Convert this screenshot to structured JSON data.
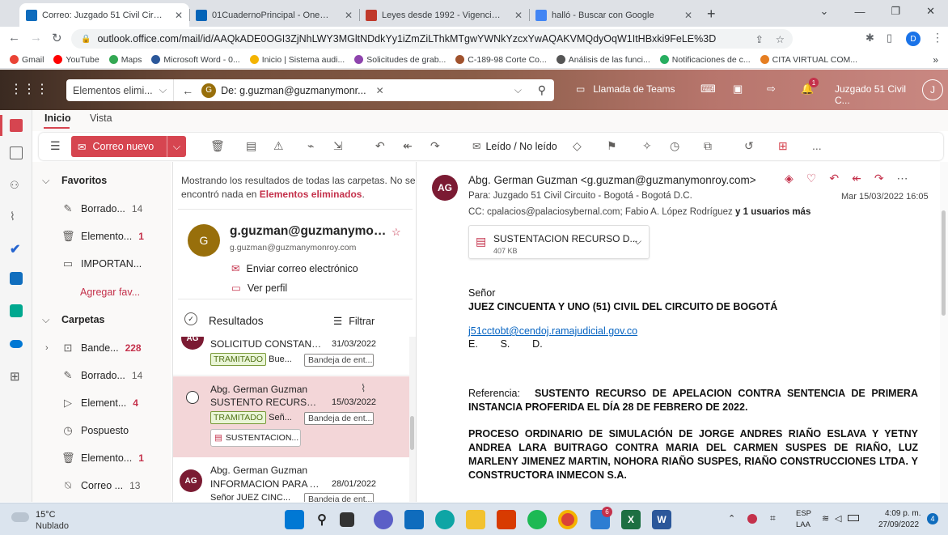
{
  "browser": {
    "tabs": [
      {
        "title": "Correo: Juzgado 51 Civil Circuito",
        "color": "#0f6cbd",
        "active": true
      },
      {
        "title": "01CuadernoPrincipal - OneDrive",
        "color": "#0364b8"
      },
      {
        "title": "Leyes desde 1992 - Vigencia exp",
        "color": "#c0392b"
      },
      {
        "title": "halló - Buscar con Google",
        "color": "#4285f4"
      }
    ],
    "new_tab": "+",
    "url": "outlook.office.com/mail/id/AAQkADE0OGI3ZjNhLWY3MGltNDdkYy1iZmZiLThkMTgwYWNkYzcxYwAQAKVMQdyOqW1ItHBxki9FeLE%3D",
    "profile": "D",
    "bookmarks": [
      {
        "label": "Gmail",
        "color": "#ea4335"
      },
      {
        "label": "YouTube",
        "color": "#ff0000"
      },
      {
        "label": "Maps",
        "color": "#34a853"
      },
      {
        "label": "Microsoft Word - 0...",
        "color": "#2b579a"
      },
      {
        "label": "Inicio | Sistema audi...",
        "color": "#f4b400"
      },
      {
        "label": "Solicitudes de grab...",
        "color": "#8e44ad"
      },
      {
        "label": "C-189-98 Corte Co...",
        "color": "#a0522d"
      },
      {
        "label": "Análisis de las funci...",
        "color": "#555555"
      },
      {
        "label": "Notificaciones de c...",
        "color": "#27ae60"
      },
      {
        "label": "CITA VIRTUAL COM...",
        "color": "#e67e22"
      }
    ],
    "more": "»"
  },
  "outlook": {
    "folder_scope": "Elementos elimi...",
    "search_chip_avatar": "G",
    "search_chip": "De: g.guzman@guzmanymonr...",
    "teams_call": "Llamada de Teams",
    "notif_count": "1",
    "account": "Juzgado 51 Civil C...",
    "account_initial": "J",
    "ribbon_tabs": [
      "Inicio",
      "Vista"
    ],
    "new_mail": "Correo nuevo",
    "read_unread": "Leído / No leído",
    "more": "..."
  },
  "folders": {
    "favorites_header": "Favoritos",
    "fav_items": [
      {
        "label": "Borrado...",
        "count": "14",
        "red": false,
        "icon": "pencil-icon"
      },
      {
        "label": "Elemento...",
        "count": "1",
        "red": true,
        "icon": "trash-icon"
      },
      {
        "label": "IMPORTAN...",
        "count": "",
        "red": false,
        "icon": "folder-icon"
      }
    ],
    "add_fav": "Agregar fav...",
    "folders_header": "Carpetas",
    "folder_items": [
      {
        "label": "Bande...",
        "count": "228",
        "red": true,
        "icon": "inbox-icon"
      },
      {
        "label": "Borrado...",
        "count": "14",
        "red": false,
        "icon": "pencil-icon"
      },
      {
        "label": "Element...",
        "count": "4",
        "red": true,
        "icon": "send-icon"
      },
      {
        "label": "Pospuesto",
        "count": "",
        "red": false,
        "icon": "clock-icon"
      },
      {
        "label": "Elemento...",
        "count": "1",
        "red": true,
        "icon": "trash-icon"
      },
      {
        "label": "Correo ...",
        "count": "13",
        "red": false,
        "icon": "junk-icon"
      }
    ]
  },
  "list": {
    "notice_prefix": "Mostrando los resultados de todas las carpetas. No se encontró nada en ",
    "notice_folder": "Elementos eliminados",
    "notice_suffix": ".",
    "contact_initial": "G",
    "contact_name": "g.guzman@guzmanymonr...",
    "contact_email": "g.guzman@guzmanymonroy.com",
    "send_email": "Enviar correo electrónico",
    "view_profile": "Ver perfil",
    "results": "Resultados",
    "filter": "Filtrar",
    "messages": [
      {
        "avatar": "AG",
        "sender": "",
        "subject": "SOLICITUD CONSTANCI...",
        "date": "31/03/2022",
        "tag": "TRAMITADO",
        "preview": "Bue...",
        "folder": "Bandeja de ent..."
      },
      {
        "avatar": "",
        "sender": "Abg. German Guzman",
        "subject": "SUSTENTO RECURSO D...",
        "date": "15/03/2022",
        "tag": "TRAMITADO",
        "preview": "Señ...",
        "folder": "Bandeja de ent...",
        "attachment": "SUSTENTACION..."
      },
      {
        "avatar": "AG",
        "sender": "Abg. German Guzman",
        "subject": "INFORMACION PARA A...",
        "date": "28/01/2022",
        "tag": "",
        "preview": "Señor JUEZ CINC...",
        "folder": "Bandeja de ent..."
      }
    ]
  },
  "reading": {
    "avatar": "AG",
    "from": "Abg. German Guzman <g.guzman@guzmanymonroy.com>",
    "to": "Para:  Juzgado 51 Civil Circuito - Bogotá - Bogotá D.C.",
    "date": "Mar 15/03/2022 16:05",
    "cc_prefix": "CC:  cpalacios@palaciosybernal.com;  Fabio A. López Rodríguez ",
    "cc_more": "y 1 usuarios más",
    "attachment_name": "SUSTENTACION RECURSO D...",
    "attachment_size": "407 KB",
    "salutation": "Señor",
    "judge": "JUEZ CINCUENTA Y UNO (51) CIVIL DEL CIRCUITO DE BOGOTÁ",
    "email_link": "j51cctobt@cendoj.ramajudicial.gov.co",
    "esd": "E.        S.        D.",
    "ref_label": "Referencia:",
    "ref_text": "SUSTENTO RECURSO DE APELACION CONTRA SENTENCIA DE PRIMERA INSTANCIA PROFERIDA EL DÍA 28 DE FEBRERO DE 2022.",
    "process_text": "PROCESO ORDINARIO DE SIMULACIÓN DE JORGE ANDRES RIAÑO ESLAVA Y YETNY ANDREA LARA BUITRAGO CONTRA MARIA DEL CARMEN SUSPES DE RIAÑO, LUZ MARLENY JIMENEZ MARTIN, NOHORA RIAÑO SUSPES, RIAÑO CONSTRUCCIONES LTDA. Y CONSTRUCTORA INMECON S.A."
  },
  "taskbar": {
    "temp": "15°C",
    "weather": "Nublado",
    "lang1": "ESP",
    "lang2": "LAA",
    "time": "4:09 p. m.",
    "date": "27/09/2022",
    "notif": "4",
    "badge": "6"
  }
}
